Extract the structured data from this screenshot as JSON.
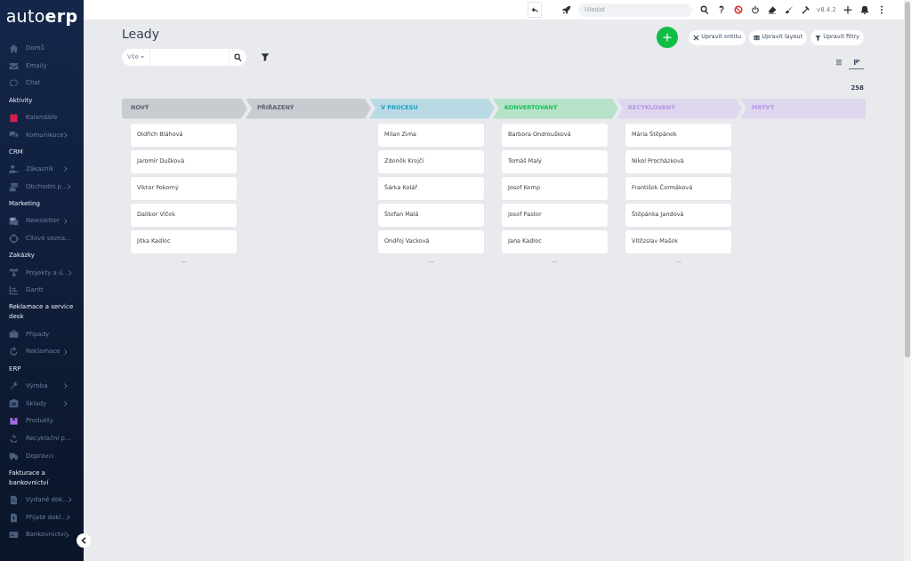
{
  "logo": "auto**erp**",
  "sidebar": {
    "items": [
      {
        "kind": "item",
        "label": "Domů",
        "expandable": false
      },
      {
        "kind": "item",
        "label": "Emaily",
        "expandable": false
      },
      {
        "kind": "item",
        "label": "Chat",
        "expandable": false
      },
      {
        "kind": "section",
        "label": "Aktivity"
      },
      {
        "kind": "item",
        "label": "Kalendáře",
        "expandable": false
      },
      {
        "kind": "item",
        "label": "Komunikace",
        "expandable": true
      },
      {
        "kind": "section",
        "label": "CRM"
      },
      {
        "kind": "item",
        "label": "Zákazník",
        "expandable": true
      },
      {
        "kind": "item",
        "label": "Obchodní p…",
        "expandable": true
      },
      {
        "kind": "section",
        "label": "Marketing"
      },
      {
        "kind": "item",
        "label": "Newsletter",
        "expandable": true
      },
      {
        "kind": "item",
        "label": "Cílové sezna…",
        "expandable": false
      },
      {
        "kind": "section",
        "label": "Zakázky"
      },
      {
        "kind": "item",
        "label": "Projekty a ú…",
        "expandable": true
      },
      {
        "kind": "item",
        "label": "Gantt",
        "expandable": false
      },
      {
        "kind": "section",
        "label": "Reklamace a service desk"
      },
      {
        "kind": "item",
        "label": "Případy",
        "expandable": false
      },
      {
        "kind": "item",
        "label": "Reklamace",
        "expandable": true
      },
      {
        "kind": "section",
        "label": "ERP"
      },
      {
        "kind": "item",
        "label": "Výroba",
        "expandable": true
      },
      {
        "kind": "item",
        "label": "Sklady",
        "expandable": true
      },
      {
        "kind": "item",
        "label": "Produkty",
        "expandable": false
      },
      {
        "kind": "item",
        "label": "Recyklační p…",
        "expandable": false
      },
      {
        "kind": "item",
        "label": "Dopravci",
        "expandable": false
      },
      {
        "kind": "section",
        "label": "Fakturace a bankovnictví"
      },
      {
        "kind": "item",
        "label": "Vydané dok…",
        "expandable": true
      },
      {
        "kind": "item",
        "label": "Přijaté dokl…",
        "expandable": true
      },
      {
        "kind": "item",
        "label": "Bankovnictví",
        "expandable": true
      }
    ]
  },
  "topbar": {
    "search": {
      "placeholder": "Hledat"
    },
    "version": "v8.4.2"
  },
  "page": {
    "title": "Leady",
    "filter": {
      "scope": "Vše"
    },
    "buttons": [
      "Upravit entitu",
      "Upravit layout",
      "Upravit filtry"
    ],
    "views": [
      {
        "selected": false
      },
      {
        "selected": true
      }
    ],
    "count": "258"
  },
  "columns": [
    {
      "label": "NOVÝ",
      "color": "#5b6471",
      "cards": [
        "Oldřich Bláhová",
        "Jaromír Dušková",
        "Viktor Pokorný",
        "Dalibor Vlček",
        "Jitka Kadlec"
      ],
      "more": "..."
    },
    {
      "label": "PŘIŘAZENÝ",
      "color": "#5b6471"
    },
    {
      "label": "V PROCESU",
      "color": "#1f9fc0",
      "cards": [
        "Milan Zima",
        "Zdeněk Krejčí",
        "Šárka Kolář",
        "Štefan Malá",
        "Ondřej Vacková"
      ],
      "more": "..."
    },
    {
      "label": "KONVERTOVANÝ",
      "color": "#18c257",
      "cards": [
        "Barbora Ondroušková",
        "Tomáš Malý",
        "Josef Kemp",
        "josef Paster",
        "Jana Kadlec"
      ],
      "more": "..."
    },
    {
      "label": "RECYKLOVANÝ",
      "color": "#b596e6",
      "cards": [
        "Mária Štěpánek",
        "Nikol Procházková",
        "František Čermáková",
        "Štěpánka Jandová",
        "Vítězslav Mašek"
      ],
      "more": "..."
    },
    {
      "label": "MRTVÝ",
      "color": "#b596e6"
    }
  ]
}
